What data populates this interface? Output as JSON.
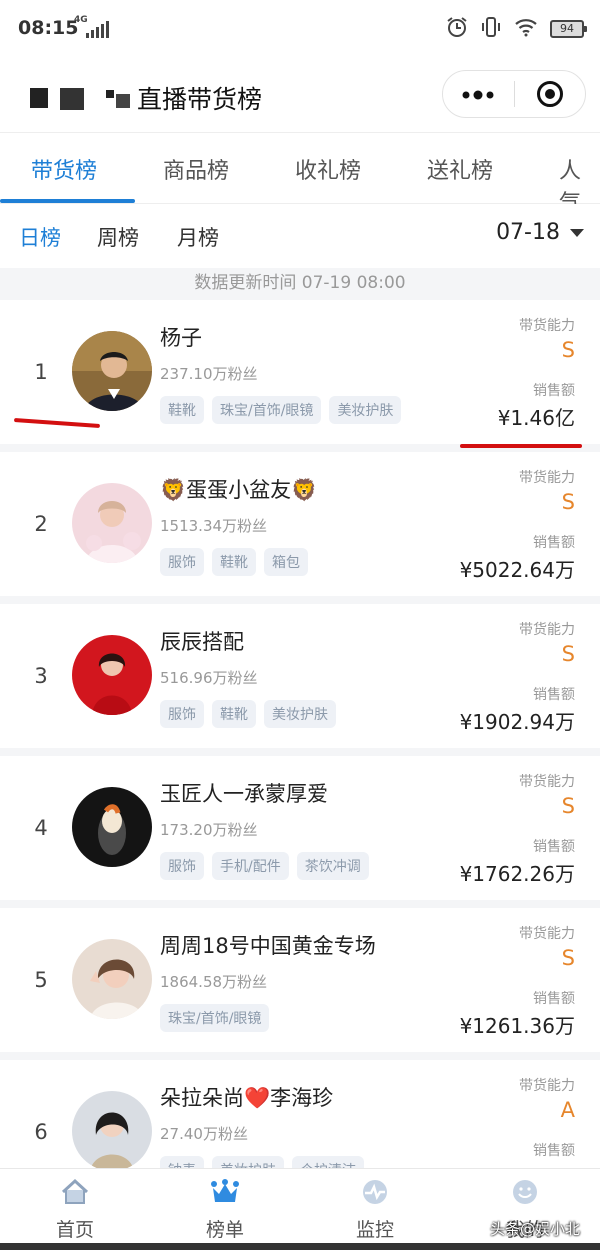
{
  "status": {
    "time": "08:15",
    "network": "4G",
    "battery": "94"
  },
  "header": {
    "title": "直播带货榜"
  },
  "main_tabs": [
    {
      "label": "带货榜",
      "active": true
    },
    {
      "label": "商品榜"
    },
    {
      "label": "收礼榜"
    },
    {
      "label": "送礼榜"
    },
    {
      "label": "人气"
    }
  ],
  "sub_tabs": [
    {
      "label": "日榜",
      "active": true
    },
    {
      "label": "周榜"
    },
    {
      "label": "月榜"
    }
  ],
  "date_select": "07-18",
  "update_time": "数据更新时间 07-19 08:00",
  "capability_label": "带货能力",
  "sales_label": "销售额",
  "rankings": [
    {
      "rank": "1",
      "name": "杨子",
      "fans": "237.10万粉丝",
      "tags": [
        "鞋靴",
        "珠宝/首饰/眼镜",
        "美妆护肤"
      ],
      "grade": "S",
      "sales": "¥1.46亿"
    },
    {
      "rank": "2",
      "name": "🦁蛋蛋小盆友🦁",
      "fans": "1513.34万粉丝",
      "tags": [
        "服饰",
        "鞋靴",
        "箱包"
      ],
      "grade": "S",
      "sales": "¥5022.64万"
    },
    {
      "rank": "3",
      "name": "辰辰搭配",
      "fans": "516.96万粉丝",
      "tags": [
        "服饰",
        "鞋靴",
        "美妆护肤"
      ],
      "grade": "S",
      "sales": "¥1902.94万"
    },
    {
      "rank": "4",
      "name": "玉匠人一承蒙厚爱",
      "fans": "173.20万粉丝",
      "tags": [
        "服饰",
        "手机/配件",
        "茶饮冲调"
      ],
      "grade": "S",
      "sales": "¥1762.26万"
    },
    {
      "rank": "5",
      "name": "周周18号中国黄金专场",
      "fans": "1864.58万粉丝",
      "tags": [
        "珠宝/首饰/眼镜"
      ],
      "grade": "S",
      "sales": "¥1261.36万"
    },
    {
      "rank": "6",
      "name": "朵拉朵尚❤️李海珍",
      "fans": "27.40万粉丝",
      "tags": [
        "钟表",
        "美妆护肤",
        "个护清洁"
      ],
      "grade": "A",
      "sales": ""
    }
  ],
  "bottom_nav": [
    {
      "label": "首页",
      "icon": "home-icon"
    },
    {
      "label": "榜单",
      "icon": "crown-icon",
      "active": true
    },
    {
      "label": "监控",
      "icon": "pulse-icon"
    },
    {
      "label": "我的",
      "icon": "face-icon"
    }
  ],
  "watermark": "头条@娱小北",
  "colors": {
    "accent": "#1e7fd6",
    "grade": "#e6862c",
    "mark": "#d30f10"
  }
}
